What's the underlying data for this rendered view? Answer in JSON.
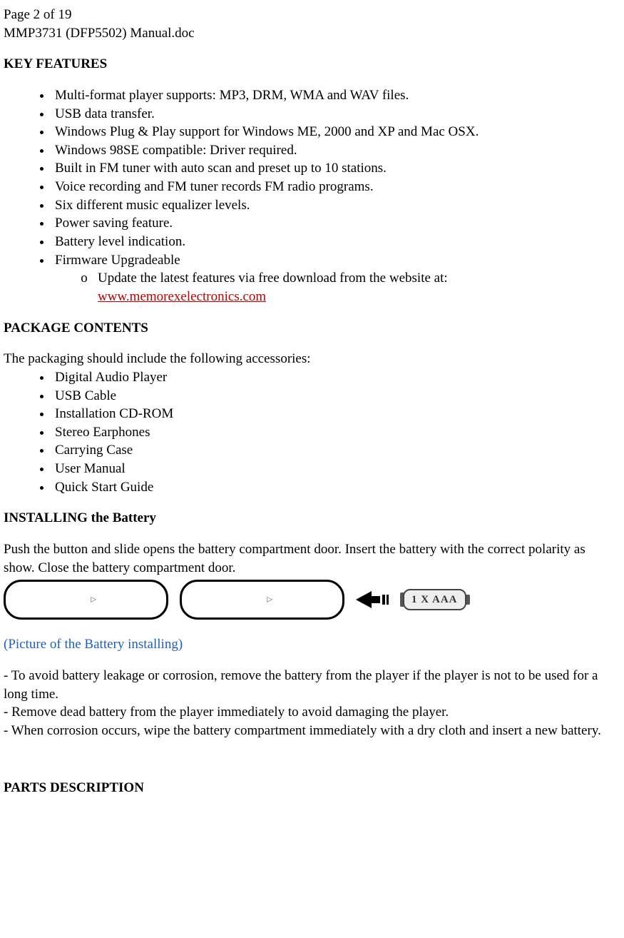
{
  "header": {
    "page_line": "Page 2 of 19",
    "doc_line": "MMP3731 (DFP5502) Manual.doc"
  },
  "sections": {
    "key_features": {
      "title": "KEY FEATURES",
      "items": [
        "Multi-format player supports:  MP3, DRM, WMA and WAV files.",
        "USB data transfer.",
        "Windows Plug & Play support for Windows ME, 2000 and XP and Mac OSX.",
        "Windows 98SE compatible: Driver required.",
        "Built in FM tuner with auto scan and preset up to 10 stations.",
        "Voice recording and FM tuner records FM radio programs.",
        "Six different music equalizer levels.",
        "Power saving feature.",
        "Battery level indication.",
        "Firmware Upgradeable"
      ],
      "sub_item_prefix": "Update the latest features via free download from the website at: ",
      "sub_item_link": "www.memorexelectronics.com"
    },
    "package_contents": {
      "title": "PACKAGE CONTENTS",
      "intro": "The packaging should include the following accessories:",
      "items": [
        "Digital Audio Player",
        "USB Cable",
        "Installation CD-ROM",
        "Stereo Earphones",
        "Carrying Case",
        "User Manual",
        "Quick Start Guide"
      ]
    },
    "installing_battery": {
      "title": "INSTALLING the Battery",
      "intro": "Push the button and slide opens the battery compartment door.  Insert the battery with the correct polarity as show.  Close the battery compartment door.",
      "battery_label": "1 X AAA",
      "caption": "(Picture of the Battery installing)",
      "notes": [
        "- To avoid battery leakage or corrosion, remove the battery from the player if the player is not to be used for a long time.",
        "- Remove dead battery from the player immediately to avoid damaging the player.",
        "- When corrosion occurs, wipe the battery compartment immediately with a dry cloth and insert a new battery."
      ]
    },
    "parts_description": {
      "title": "PARTS DESCRIPTION"
    }
  }
}
